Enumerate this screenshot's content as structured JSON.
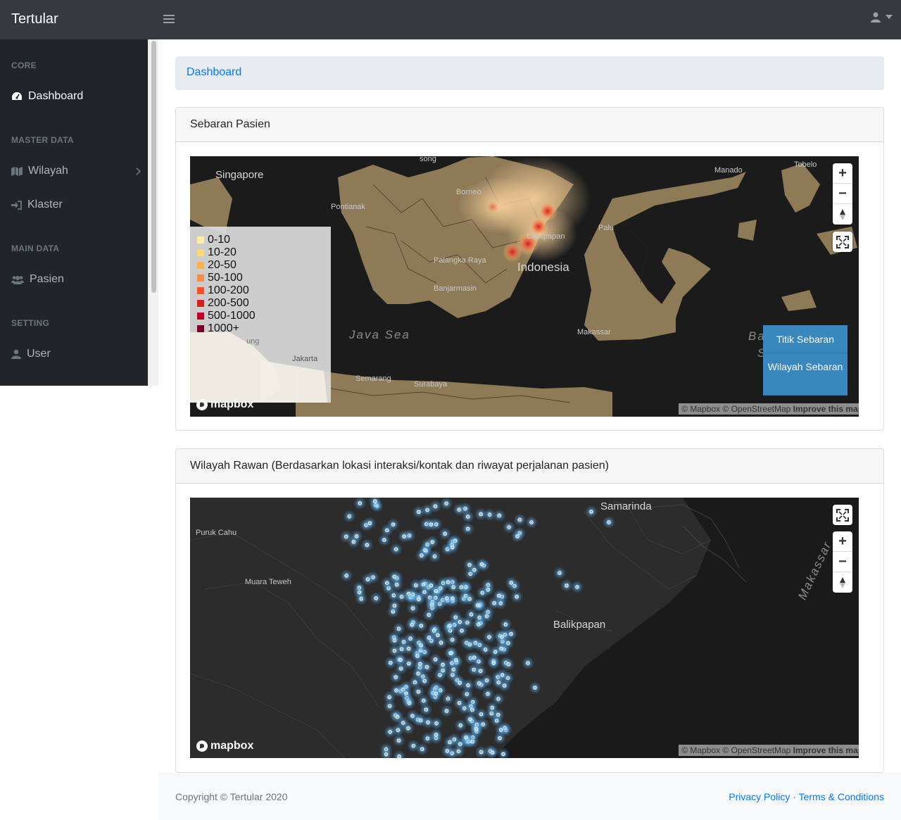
{
  "app": {
    "brand": "Tertular"
  },
  "sidebar": {
    "headings": {
      "core": "CORE",
      "master": "MASTER DATA",
      "main": "MAIN DATA",
      "setting": "SETTING"
    },
    "items": {
      "dashboard": {
        "label": "Dashboard",
        "icon": "tachometer-icon",
        "active": true
      },
      "wilayah": {
        "label": "Wilayah",
        "icon": "map-icon"
      },
      "klaster": {
        "label": "Klaster",
        "icon": "sign-in-icon"
      },
      "pasien": {
        "label": "Pasien",
        "icon": "users-icon"
      },
      "user": {
        "label": "User",
        "icon": "user-icon"
      }
    }
  },
  "breadcrumb": {
    "label": "Dashboard"
  },
  "card1": {
    "title": "Sebaran Pasien",
    "places": {
      "singapore": "Singapore",
      "song": "song",
      "manado": "Manado",
      "tobelo": "Tobelo",
      "pontianak": "Pontianak",
      "borneo": "Borneo",
      "palu": "Palu",
      "balikpapan": "Balikpapan",
      "palangka": "Palangka Raya",
      "indonesia": "Indonesia",
      "banjarmasin": "Banjarmasin",
      "java_sea": "Java Sea",
      "makassar": "Makassar",
      "ba": "Ba",
      "s": "S",
      "lampung": "ung",
      "jakarta": "Jakarta",
      "semarang": "Semarang",
      "surabaya": "Surabaya"
    },
    "legend": [
      "0-10",
      "10-20",
      "20-50",
      "50-100",
      "100-200",
      "200-500",
      "500-1000",
      "1000+"
    ],
    "legend_colors": [
      "#ffeda0",
      "#fed976",
      "#feb24c",
      "#fd8d3c",
      "#fc4e2a",
      "#e31a1c",
      "#bd0026",
      "#800026"
    ],
    "layers": {
      "titik": "Titik Sebaran",
      "wilayah": "Wilayah Sebaran"
    }
  },
  "card2": {
    "title": "Wilayah Rawan (Berdasarkan lokasi interaksi/kontak dan riwayat perjalanan pasien)",
    "places": {
      "samarinda": "Samarinda",
      "puruk": "Puruk Cahu",
      "muara": "Muara Teweh",
      "balikpapan": "Balikpapan",
      "makassar_strait": "Makassar"
    }
  },
  "map_common": {
    "logo": "mapbox",
    "attribution": "© Mapbox © OpenStreetMap",
    "improve": "Improve this map",
    "zoom_in": "+",
    "zoom_out": "−"
  },
  "footer": {
    "copyright": "Copyright © Tertular 2020",
    "privacy": "Privacy Policy",
    "separator": "·",
    "terms": "Terms & Conditions"
  }
}
